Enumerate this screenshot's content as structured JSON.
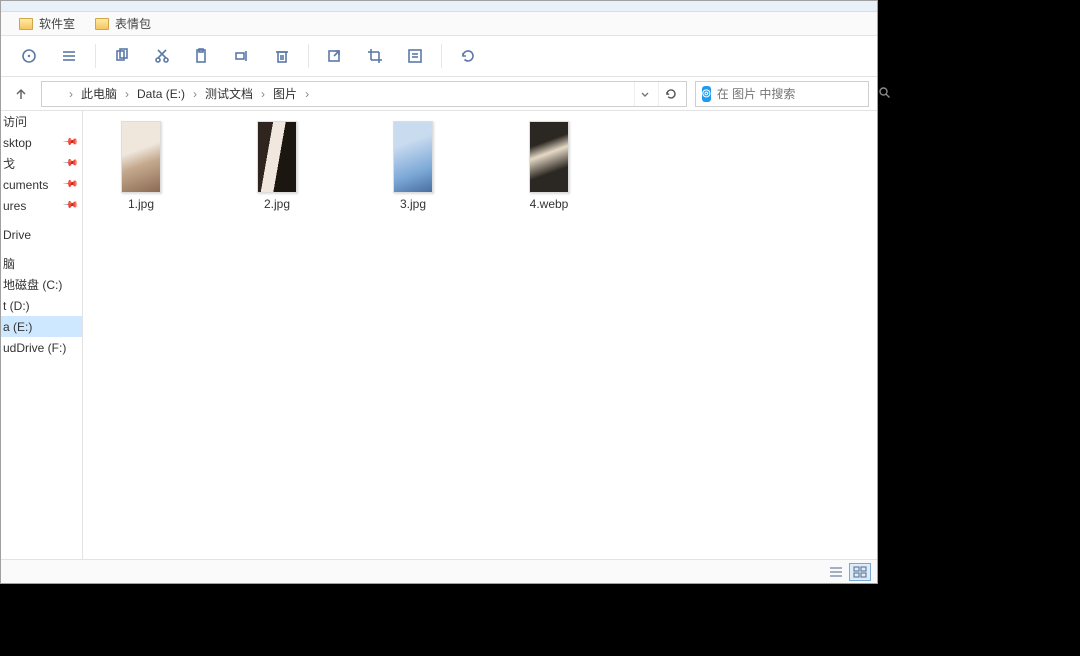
{
  "bookmarks": [
    {
      "label": "软件室"
    },
    {
      "label": "表情包"
    }
  ],
  "breadcrumb": {
    "items": [
      "此电脑",
      "Data (E:)",
      "测试文档",
      "图片"
    ]
  },
  "search": {
    "placeholder": "在 图片 中搜索"
  },
  "sidebar": {
    "items": [
      {
        "label": "访问",
        "pinned": false
      },
      {
        "label": "sktop",
        "pinned": true
      },
      {
        "label": "戈",
        "pinned": true
      },
      {
        "label": "cuments",
        "pinned": true
      },
      {
        "label": "ures",
        "pinned": true
      }
    ],
    "groups": [
      {
        "label": "Drive"
      },
      {
        "label": "脑"
      },
      {
        "label": "地磁盘 (C:)"
      },
      {
        "label": "t (D:)"
      },
      {
        "label": "a (E:)",
        "selected": true
      },
      {
        "label": "udDrive (F:)"
      }
    ]
  },
  "files": [
    {
      "name": "1.jpg"
    },
    {
      "name": "2.jpg"
    },
    {
      "name": "3.jpg"
    },
    {
      "name": "4.webp"
    }
  ]
}
